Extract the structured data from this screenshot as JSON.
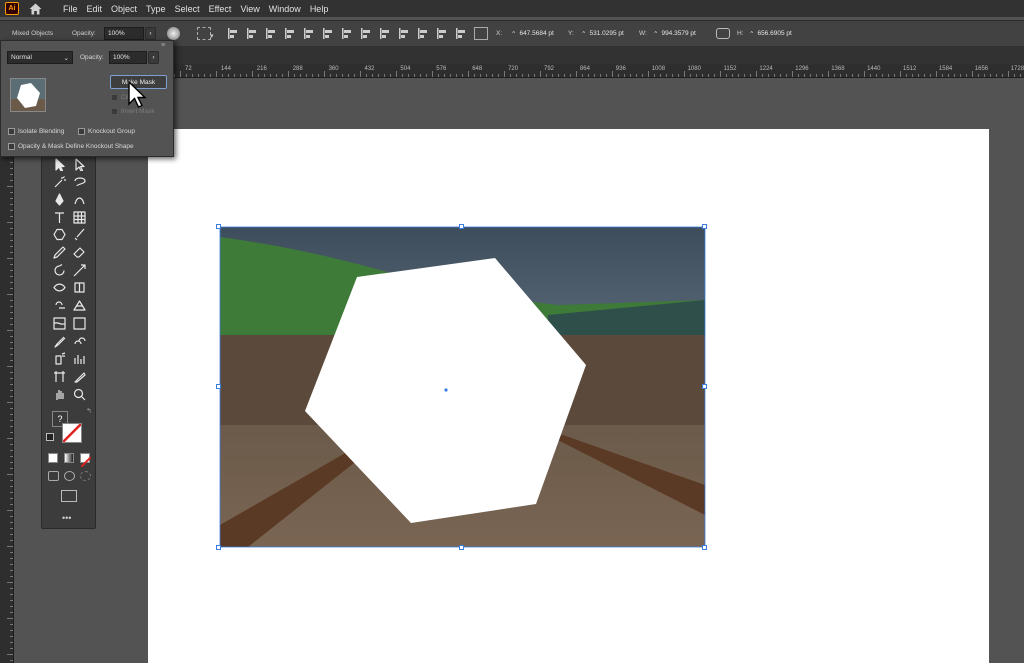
{
  "app": {
    "logo_text": "Ai"
  },
  "menu": [
    "File",
    "Edit",
    "Object",
    "Type",
    "Select",
    "Effect",
    "View",
    "Window",
    "Help"
  ],
  "control_bar": {
    "selection_label": "Mixed Objects",
    "opacity_label": "Opacity:",
    "opacity_value": "100%",
    "x_label": "X:",
    "x_value": "647.5684 pt",
    "y_label": "Y:",
    "y_value": "531.0295 pt",
    "w_label": "W:",
    "w_value": "994.3579 pt",
    "h_label": "H:",
    "h_value": "656.6905 pt"
  },
  "ruler_top_ticks": [
    "72",
    "144",
    "216",
    "288",
    "360",
    "432",
    "504",
    "576",
    "648",
    "720",
    "792",
    "864",
    "936",
    "1008",
    "1080",
    "1152",
    "1224",
    "1296",
    "1368",
    "1440",
    "1512",
    "1584",
    "1656",
    "1728"
  ],
  "transparency_panel": {
    "blend_mode": "Normal",
    "opacity_label": "Opacity:",
    "opacity_value": "100%",
    "make_mask_label": "Make Mask",
    "clip_label": "Clip",
    "invert_mask_label": "Invert Mask",
    "isolate_blending_label": "Isolate Blending",
    "knockout_group_label": "Knockout Group",
    "opacity_mask_label": "Opacity & Mask Define Knockout Shape"
  },
  "toolbar": {
    "help_glyph": "?",
    "more_glyph": "•••"
  },
  "colors": {
    "app_bg": "#535353",
    "menubar": "#323232",
    "selection": "#3b7ddd",
    "accent": "#ff9a00"
  }
}
